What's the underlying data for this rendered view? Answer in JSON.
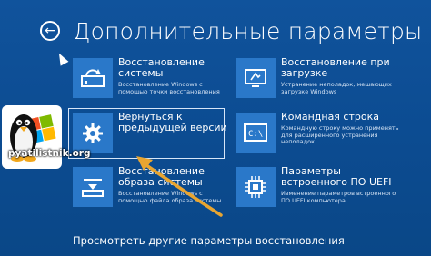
{
  "header": {
    "title": "Дополнительные параметры"
  },
  "tiles": [
    {
      "title_lines": [
        "Восстановление",
        "системы"
      ],
      "desc_lines": [
        "Восстановление Windows с",
        "помощью точки восстановления"
      ],
      "icon": "restore-icon"
    },
    {
      "title_lines": [
        "Восстановление при",
        "загрузке"
      ],
      "desc_lines": [
        "Устранение неполадок, мешающих",
        "загрузке Windows"
      ],
      "icon": "startup-repair-icon"
    },
    {
      "title_lines": [
        "Вернуться к",
        "предыдущей версии"
      ],
      "desc_lines": [],
      "icon": "gear-icon"
    },
    {
      "title_lines": [
        "Командная строка"
      ],
      "desc_lines": [
        "Командную строку можно применять",
        "для расширенного устранения",
        "неполадок"
      ],
      "icon": "command-prompt-icon"
    },
    {
      "title_lines": [
        "Восстановление",
        "образа системы"
      ],
      "desc_lines": [
        "Восстановление Windows с",
        "помощью файла образа системы"
      ],
      "icon": "system-image-icon"
    },
    {
      "title_lines": [
        "Параметры",
        "встроенного ПО UEFI"
      ],
      "desc_lines": [
        "Изменение параметров встроенного",
        "ПО UEFI компьютера"
      ],
      "icon": "uefi-chip-icon"
    }
  ],
  "footer": {
    "more_link": "Просмотреть другие параметры восстановления"
  },
  "watermark": {
    "site": "pyatilistnik.org"
  },
  "colors": {
    "background": "#0d4a8f",
    "tile_icon": "#2a78c9",
    "annotation_arrow": "#e8a531"
  }
}
